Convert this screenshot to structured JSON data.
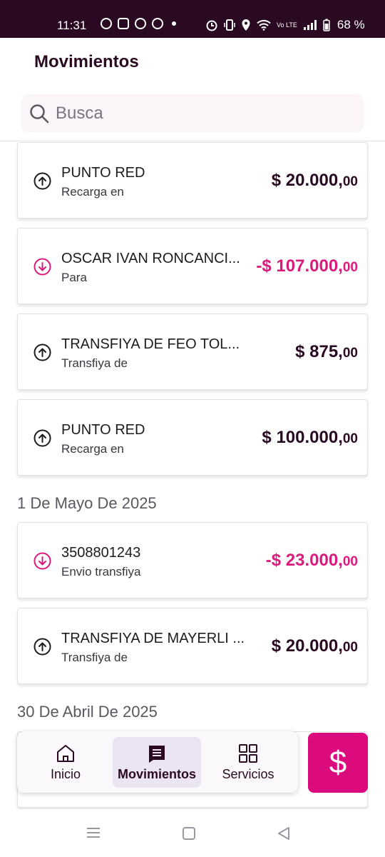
{
  "status_bar": {
    "time": "11:31",
    "network": "Vo LTE",
    "battery": "68 %"
  },
  "page": {
    "title": "Movimientos"
  },
  "search": {
    "placeholder": "Busca"
  },
  "groups": [
    {
      "date": "",
      "transactions": [
        {
          "direction": "in",
          "name": "PUNTO RED",
          "subtitle": "Recarga en",
          "amount_main": "$ 20.000,",
          "amount_cents": "00"
        },
        {
          "direction": "out",
          "name": "OSCAR IVAN RONCANCI...",
          "subtitle": "Para",
          "amount_main": "-$ 107.000,",
          "amount_cents": "00"
        },
        {
          "direction": "in",
          "name": "TRANSFIYA DE FEO TOL...",
          "subtitle": "Transfiya de",
          "amount_main": "$ 875,",
          "amount_cents": "00"
        },
        {
          "direction": "in",
          "name": "PUNTO RED",
          "subtitle": "Recarga en",
          "amount_main": "$ 100.000,",
          "amount_cents": "00"
        }
      ]
    },
    {
      "date": "1 De Mayo De 2025",
      "transactions": [
        {
          "direction": "out",
          "name": "3508801243",
          "subtitle": "Envio transfiya",
          "amount_main": "-$ 23.000,",
          "amount_cents": "00"
        },
        {
          "direction": "in",
          "name": "TRANSFIYA DE MAYERLI ...",
          "subtitle": "Transfiya de",
          "amount_main": "$ 20.000,",
          "amount_cents": "00"
        }
      ]
    },
    {
      "date": "30 De Abril De 2025",
      "transactions": []
    }
  ],
  "bottom_nav": {
    "items": [
      {
        "label": "Inicio",
        "icon": "home-icon",
        "active": false
      },
      {
        "label": "Movimientos",
        "icon": "receipt-icon",
        "active": true
      },
      {
        "label": "Servicios",
        "icon": "grid-icon",
        "active": false
      }
    ]
  },
  "fab": {
    "symbol": "$",
    "icon": "dollar-icon"
  },
  "colors": {
    "brand": "#db0b7e",
    "negative_amount": "#db1a7e",
    "status_bar": "#2a0a22",
    "active_nav_bg": "#eae4f3"
  }
}
